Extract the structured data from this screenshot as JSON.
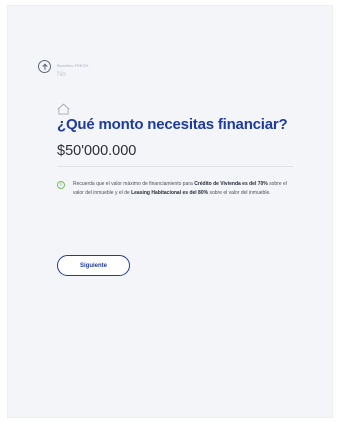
{
  "previous_step": {
    "label": "Beneficio FRECH",
    "value": "No"
  },
  "question": {
    "icon": "house-icon",
    "title": "¿Qué monto necesitas financiar?"
  },
  "amount": {
    "value": "$50'000.000"
  },
  "info": {
    "icon": "info-icon",
    "accent_color": "#74c05a",
    "text_1": "Recuerda que el valor máximo de financiamiento para ",
    "bold_1": "Crédito de Vivienda es del 70%",
    "text_2": " sobre el valor del inmueble y el de ",
    "bold_2": "Leasing Habitacional es del 80%",
    "text_3": " sobre el valor del inmueble."
  },
  "actions": {
    "next_label": "Siguiente"
  },
  "colors": {
    "brand": "#1d3ba0",
    "background": "#f4f5f8"
  }
}
